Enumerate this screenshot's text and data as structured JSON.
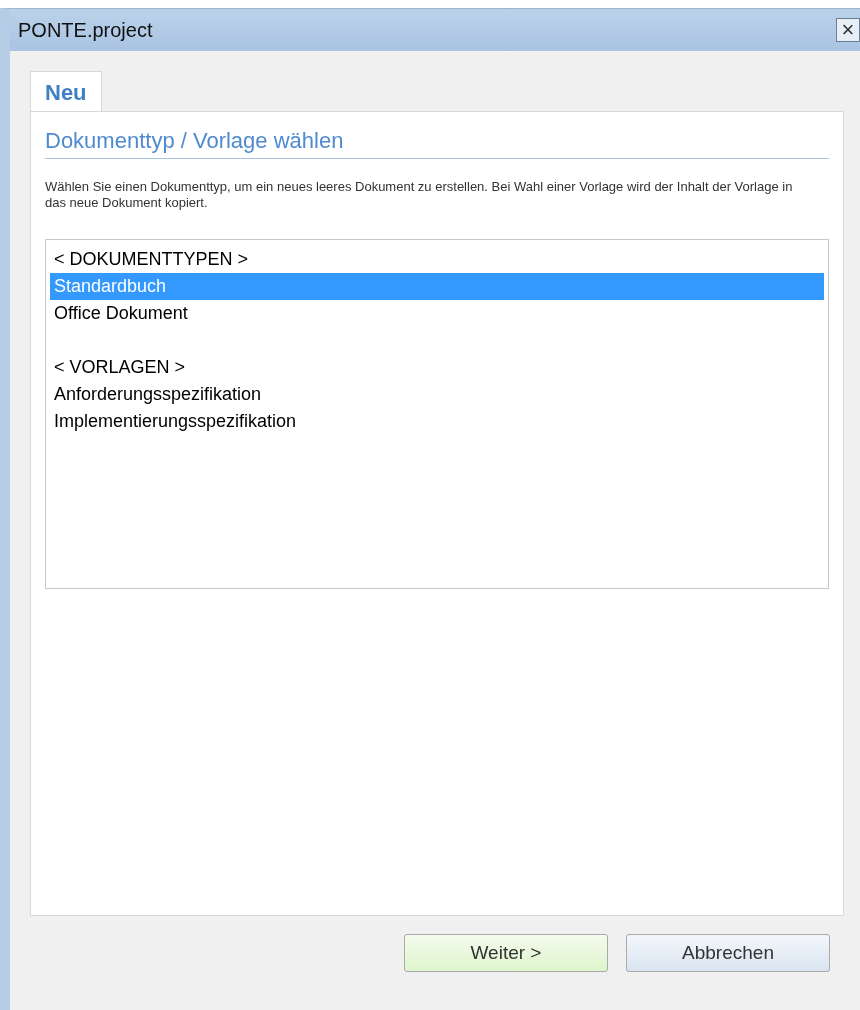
{
  "window": {
    "title": "PONTE.project",
    "close": "×"
  },
  "tabs": [
    {
      "label": "Neu",
      "selected": true
    }
  ],
  "section": {
    "heading": "Dokumenttyp / Vorlage wählen",
    "description": "Wählen Sie einen Dokumenttyp, um ein neues leeres Dokument zu erstellen. Bei Wahl einer Vorlage wird der Inhalt der Vorlage in das neue Dokument kopiert."
  },
  "list": [
    {
      "kind": "item",
      "label": "< DOKUMENTTYPEN >",
      "selected": false
    },
    {
      "kind": "item",
      "label": "Standardbuch",
      "selected": true
    },
    {
      "kind": "item",
      "label": "Office Dokument",
      "selected": false
    },
    {
      "kind": "spacer"
    },
    {
      "kind": "item",
      "label": "< VORLAGEN >",
      "selected": false
    },
    {
      "kind": "item",
      "label": "Anforderungsspezifikation",
      "selected": false
    },
    {
      "kind": "item",
      "label": "Implementierungsspezifikation",
      "selected": false
    }
  ],
  "buttons": [
    {
      "kind": "primary",
      "label": "Weiter >"
    },
    {
      "kind": "normal",
      "label": "Abbrechen"
    }
  ]
}
